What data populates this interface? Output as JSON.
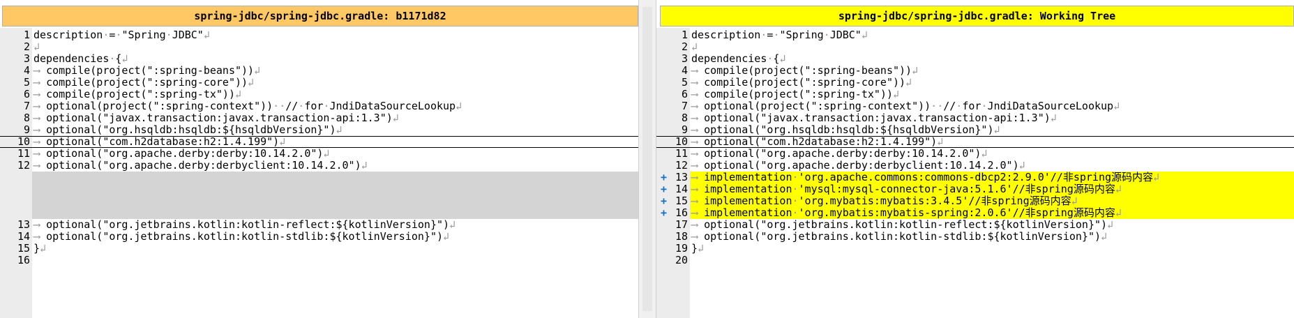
{
  "left": {
    "header": "spring-jdbc/spring-jdbc.gradle: b1171d82",
    "header_color": "#ffc864",
    "lines": [
      {
        "n": "1",
        "text": "description·=·\"Spring·JDBC\"↲"
      },
      {
        "n": "2",
        "text": "↲"
      },
      {
        "n": "3",
        "text": "dependencies·{↲"
      },
      {
        "n": "4",
        "text": "⟶compile(project(\":spring-beans\"))↲"
      },
      {
        "n": "5",
        "text": "⟶compile(project(\":spring-core\"))↲"
      },
      {
        "n": "6",
        "text": "⟶compile(project(\":spring-tx\"))↲"
      },
      {
        "n": "7",
        "text": "⟶optional(project(\":spring-context\"))··//·for·JndiDataSourceLookup↲"
      },
      {
        "n": "8",
        "text": "⟶optional(\"javax.transaction:javax.transaction-api:1.3\")↲"
      },
      {
        "n": "9",
        "text": "⟶optional(\"org.hsqldb:hsqldb:${hsqldbVersion}\")↲"
      },
      {
        "n": "10",
        "text": "⟶optional(\"com.h2database:h2:1.4.199\")↲"
      },
      {
        "n": "11",
        "text": "⟶optional(\"org.apache.derby:derby:10.14.2.0\")↲"
      },
      {
        "n": "12",
        "text": "⟶optional(\"org.apache.derby:derbyclient:10.14.2.0\")↲"
      },
      {
        "n": "13",
        "text": "⟶optional(\"org.jetbrains.kotlin:kotlin-reflect:${kotlinVersion}\")↲"
      },
      {
        "n": "14",
        "text": "⟶optional(\"org.jetbrains.kotlin:kotlin-stdlib:${kotlinVersion}\")↲"
      },
      {
        "n": "15",
        "text": "}↲"
      },
      {
        "n": "16",
        "text": ""
      }
    ]
  },
  "right": {
    "header": "spring-jdbc/spring-jdbc.gradle: Working Tree",
    "header_color": "#ffff00",
    "lines": [
      {
        "n": "1",
        "text": "description·=·\"Spring·JDBC\"↲"
      },
      {
        "n": "2",
        "text": "↲"
      },
      {
        "n": "3",
        "text": "dependencies·{↲"
      },
      {
        "n": "4",
        "text": "⟶compile(project(\":spring-beans\"))↲"
      },
      {
        "n": "5",
        "text": "⟶compile(project(\":spring-core\"))↲"
      },
      {
        "n": "6",
        "text": "⟶compile(project(\":spring-tx\"))↲"
      },
      {
        "n": "7",
        "text": "⟶optional(project(\":spring-context\"))··//·for·JndiDataSourceLookup↲"
      },
      {
        "n": "8",
        "text": "⟶optional(\"javax.transaction:javax.transaction-api:1.3\")↲"
      },
      {
        "n": "9",
        "text": "⟶optional(\"org.hsqldb:hsqldb:${hsqldbVersion}\")↲"
      },
      {
        "n": "10",
        "text": "⟶optional(\"com.h2database:h2:1.4.199\")↲"
      },
      {
        "n": "11",
        "text": "⟶optional(\"org.apache.derby:derby:10.14.2.0\")↲"
      },
      {
        "n": "12",
        "text": "⟶optional(\"org.apache.derby:derbyclient:10.14.2.0\")↲"
      },
      {
        "n": "13",
        "text": "⟶implementation·'org.apache.commons:commons-dbcp2:2.9.0'//非spring源码内容↲",
        "marker": "+"
      },
      {
        "n": "14",
        "text": "⟶implementation·'mysql:mysql-connector-java:5.1.6'//非spring源码内容↲",
        "marker": "+"
      },
      {
        "n": "15",
        "text": "⟶implementation·'org.mybatis:mybatis:3.4.5'//非spring源码内容↲",
        "marker": "+"
      },
      {
        "n": "16",
        "text": "⟶implementation·'org.mybatis:mybatis-spring:2.0.6'//非spring源码内容↲",
        "marker": "+"
      },
      {
        "n": "17",
        "text": "⟶optional(\"org.jetbrains.kotlin:kotlin-reflect:${kotlinVersion}\")↲"
      },
      {
        "n": "18",
        "text": "⟶optional(\"org.jetbrains.kotlin:kotlin-stdlib:${kotlinVersion}\")↲"
      },
      {
        "n": "19",
        "text": "}↲"
      },
      {
        "n": "20",
        "text": ""
      }
    ]
  }
}
